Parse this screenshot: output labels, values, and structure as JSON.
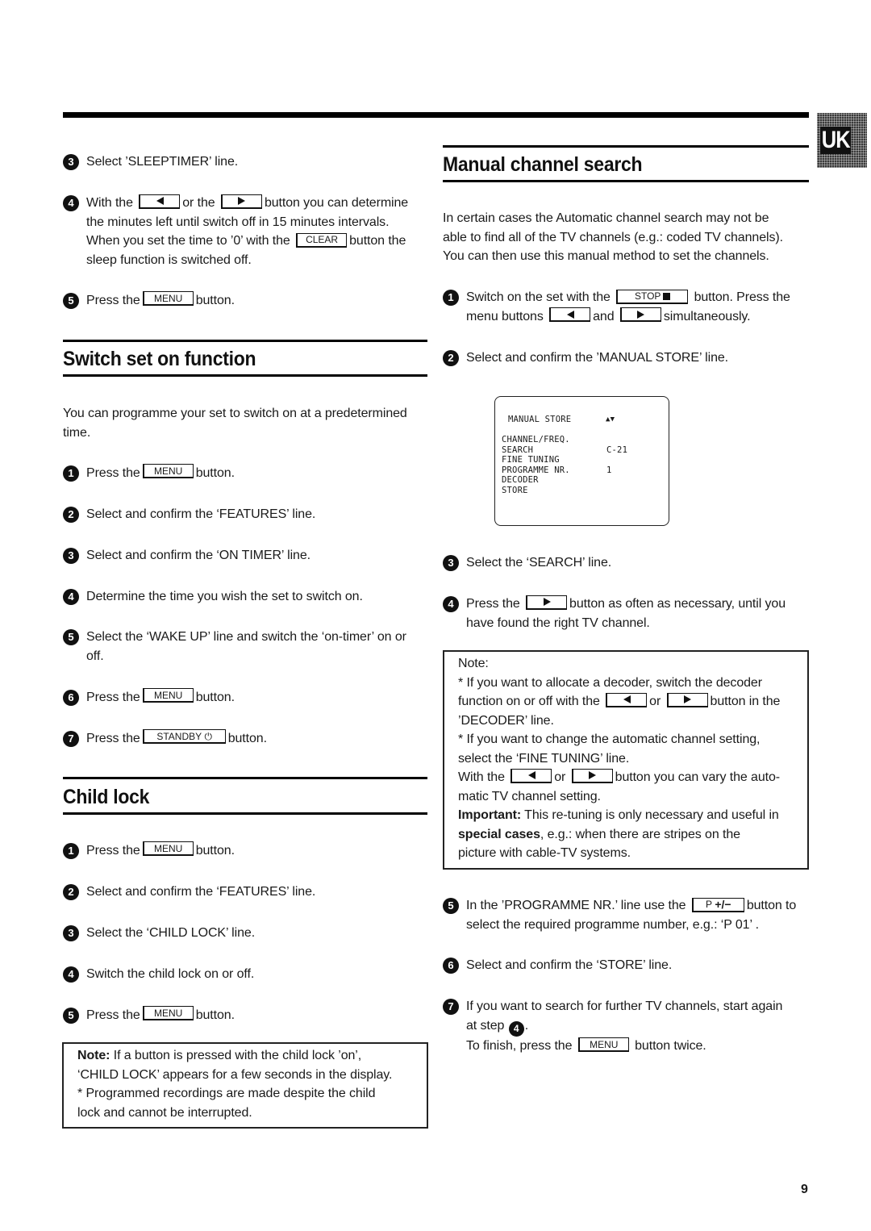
{
  "badge": {
    "label": "UK"
  },
  "page_number": "9",
  "left": {
    "sleeptimer_steps": [
      {
        "n": "3",
        "text": "Select ’SLEEPTIMER’ line."
      },
      {
        "n": "4",
        "l1a": "With the",
        "l1b": "or the",
        "l1c": "button you can determine",
        "l2": "the minutes left until switch off in 15 minutes intervals.",
        "l3a": "When you set the time to ’0’ with the",
        "l3b": "button the",
        "l4": "sleep function is switched off."
      },
      {
        "n": "5",
        "a": "Press the",
        "b": "button."
      }
    ],
    "switch_on": {
      "title": "Switch set on function",
      "intro_l1": "You can programme your set to switch on at a predetermined",
      "intro_l2": "time.",
      "steps": [
        {
          "n": "1",
          "a": "Press the",
          "b": "button."
        },
        {
          "n": "2",
          "text": "Select and confirm the ‘FEATURES’ line."
        },
        {
          "n": "3",
          "text": "Select and confirm the ‘ON TIMER’ line."
        },
        {
          "n": "4",
          "text": "Determine the time you wish the set to switch on."
        },
        {
          "n": "5",
          "l1": "Select the ‘WAKE UP’ line and switch the ‘on-timer’ on or",
          "l2": "off."
        },
        {
          "n": "6",
          "a": "Press the",
          "b": "button."
        },
        {
          "n": "7",
          "a": "Press the",
          "b": "button."
        }
      ]
    },
    "child_lock": {
      "title": "Child lock",
      "steps": [
        {
          "n": "1",
          "a": "Press the",
          "b": "button."
        },
        {
          "n": "2",
          "text": "Select and confirm the ‘FEATURES’ line."
        },
        {
          "n": "3",
          "text": "Select the ‘CHILD LOCK’ line."
        },
        {
          "n": "4",
          "text": "Switch the child lock on or off."
        },
        {
          "n": "5",
          "a": "Press the",
          "b": "button."
        }
      ],
      "note": {
        "label": "Note:",
        "l1": " If a button is pressed with the child lock ’on’,",
        "l2": "‘CHILD LOCK’ appears for a few seconds in the display.",
        "l3": "* Programmed recordings are made despite the child",
        "l4": "lock and cannot be interrupted."
      }
    }
  },
  "right": {
    "manual_search": {
      "title": "Manual channel search",
      "intro": [
        "In certain cases the Automatic channel search may not be",
        "able to find all of the TV channels (e.g.: coded TV channels).",
        "You can then use this manual method to set the channels."
      ],
      "step1": {
        "n": "1",
        "a": "Switch on the set with the",
        "b": "button. Press the",
        "c": "menu buttons",
        "d": "and",
        "e": "simultaneously."
      },
      "step2": {
        "n": "2",
        "text": "Select and confirm the ’MANUAL STORE’ line."
      },
      "screen": {
        "title": "MANUAL STORE",
        "arrows": "▲▼",
        "rows": [
          {
            "label": "CHANNEL/FREQ.",
            "value": ""
          },
          {
            "label": "SEARCH",
            "value": "C-21"
          },
          {
            "label": "FINE TUNING",
            "value": ""
          },
          {
            "label": "PROGRAMME NR.",
            "value": "1"
          },
          {
            "label": "DECODER",
            "value": ""
          },
          {
            "label": "STORE",
            "value": ""
          }
        ]
      },
      "step3": {
        "n": "3",
        "text": "Select the ‘SEARCH’ line."
      },
      "step4": {
        "n": "4",
        "a": "Press the",
        "b": "button as often as necessary, until you",
        "c": "have found the right TV channel."
      },
      "note": {
        "label": "Note:",
        "l1": "* If you want to allocate a decoder, switch the decoder",
        "l2a": "function on or off with the",
        "l2b": "or",
        "l2c": "button in the",
        "l3": "’DECODER’ line.",
        "l4": "* If you want to change the automatic channel setting,",
        "l5": "select the ‘FINE TUNING’ line.",
        "l6a": "With the",
        "l6b": "or",
        "l6c": "button you can vary the auto-",
        "l7": "matic TV channel setting.",
        "l8_bold": "Important:",
        "l8": " This re-tuning is only necessary and useful in",
        "l9_bold": "special cases",
        "l9": ", e.g.: when there are stripes on the",
        "l10": "picture with cable-TV systems."
      },
      "step5": {
        "n": "5",
        "a": "In the ’PROGRAMME NR.’ line use the",
        "b": "button to",
        "c": "select the required programme number, e.g.: ‘P 01’ ."
      },
      "step6": {
        "n": "6",
        "text": "Select and confirm the ‘STORE’ line."
      },
      "step7": {
        "n": "7",
        "a": "If you want to search for further TV channels, start again",
        "b": "at step",
        "ref": "4",
        "c": ".",
        "d": "To finish, press the",
        "e": "button twice."
      }
    }
  },
  "buttons": {
    "menu": "MENU",
    "clear": "CLEAR",
    "standby": "STANDBY",
    "standby_icon": "⏻",
    "stop": "STOP",
    "prog": "P",
    "prog_sign": "+/−"
  }
}
